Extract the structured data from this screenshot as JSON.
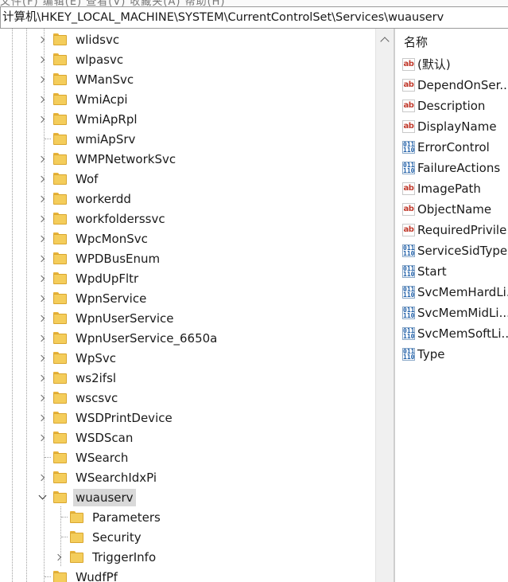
{
  "address_bar": {
    "path": "计算机\\HKEY_LOCAL_MACHINE\\SYSTEM\\CurrentControlSet\\Services\\wuauserv"
  },
  "menu_strip": {
    "text": "文件(F)  编辑(E)  查看(V)  收藏夹(A)  帮助(H)"
  },
  "tree": {
    "items": [
      {
        "label": "wlidsvc",
        "expander": "right",
        "level": 1
      },
      {
        "label": "wlpasvc",
        "expander": "right",
        "level": 1
      },
      {
        "label": "WManSvc",
        "expander": "right",
        "level": 1
      },
      {
        "label": "WmiAcpi",
        "expander": "right",
        "level": 1
      },
      {
        "label": "WmiApRpl",
        "expander": "right",
        "level": 1
      },
      {
        "label": "wmiApSrv",
        "expander": "none",
        "level": 1
      },
      {
        "label": "WMPNetworkSvc",
        "expander": "right",
        "level": 1
      },
      {
        "label": "Wof",
        "expander": "right",
        "level": 1
      },
      {
        "label": "workerdd",
        "expander": "right",
        "level": 1
      },
      {
        "label": "workfolderssvc",
        "expander": "right",
        "level": 1
      },
      {
        "label": "WpcMonSvc",
        "expander": "right",
        "level": 1
      },
      {
        "label": "WPDBusEnum",
        "expander": "right",
        "level": 1
      },
      {
        "label": "WpdUpFltr",
        "expander": "right",
        "level": 1
      },
      {
        "label": "WpnService",
        "expander": "right",
        "level": 1
      },
      {
        "label": "WpnUserService",
        "expander": "right",
        "level": 1
      },
      {
        "label": "WpnUserService_6650a",
        "expander": "right",
        "level": 1
      },
      {
        "label": "WpSvc",
        "expander": "right",
        "level": 1
      },
      {
        "label": "ws2ifsl",
        "expander": "right",
        "level": 1
      },
      {
        "label": "wscsvc",
        "expander": "right",
        "level": 1
      },
      {
        "label": "WSDPrintDevice",
        "expander": "right",
        "level": 1
      },
      {
        "label": "WSDScan",
        "expander": "right",
        "level": 1
      },
      {
        "label": "WSearch",
        "expander": "none",
        "level": 1
      },
      {
        "label": "WSearchIdxPi",
        "expander": "right",
        "level": 1
      },
      {
        "label": "wuauserv",
        "expander": "down",
        "level": 1,
        "selected": true
      },
      {
        "label": "Parameters",
        "expander": "none",
        "level": 2
      },
      {
        "label": "Security",
        "expander": "none",
        "level": 2
      },
      {
        "label": "TriggerInfo",
        "expander": "right",
        "level": 2
      },
      {
        "label": "WudfPf",
        "expander": "none",
        "level": 1
      }
    ]
  },
  "values_list": {
    "column_name": "名称",
    "items": [
      {
        "name": "(默认)",
        "type": "string"
      },
      {
        "name": "DependOnSer...",
        "type": "string"
      },
      {
        "name": "Description",
        "type": "string"
      },
      {
        "name": "DisplayName",
        "type": "string"
      },
      {
        "name": "ErrorControl",
        "type": "binary"
      },
      {
        "name": "FailureActions",
        "type": "binary"
      },
      {
        "name": "ImagePath",
        "type": "string"
      },
      {
        "name": "ObjectName",
        "type": "string"
      },
      {
        "name": "RequiredPrivile...",
        "type": "string"
      },
      {
        "name": "ServiceSidType",
        "type": "binary"
      },
      {
        "name": "Start",
        "type": "binary"
      },
      {
        "name": "SvcMemHardLi...",
        "type": "binary"
      },
      {
        "name": "SvcMemMidLi...",
        "type": "binary"
      },
      {
        "name": "SvcMemSoftLi...",
        "type": "binary"
      },
      {
        "name": "Type",
        "type": "binary"
      }
    ],
    "icon_text": {
      "string": "ab",
      "binary": "011"
    }
  },
  "icons": {
    "string_value": "string-value-icon",
    "binary_value": "binary-value-icon",
    "folder": "folder-icon"
  },
  "colors": {
    "folder": "#f4cd5b",
    "selection": "#d9d9d9",
    "string_icon": "#c0392b",
    "binary_icon": "#1f5fa8"
  }
}
